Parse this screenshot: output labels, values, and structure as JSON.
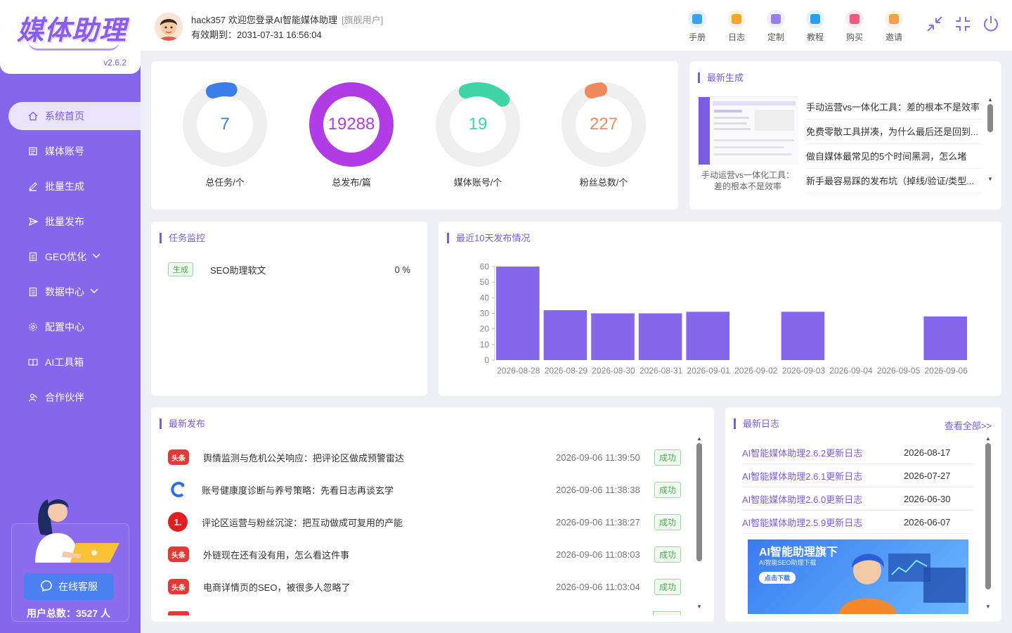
{
  "brand": {
    "logo": "媒体助理",
    "version": "v2.6.2",
    "accent": "#8666ea"
  },
  "sidebar": {
    "items": [
      {
        "label": "系统首页",
        "icon": "home-icon",
        "active": true
      },
      {
        "label": "媒体账号",
        "icon": "list-icon"
      },
      {
        "label": "批量生成",
        "icon": "edit-icon"
      },
      {
        "label": "批量发布",
        "icon": "send-icon"
      },
      {
        "label": "GEO优化",
        "icon": "doc-icon",
        "expandable": true
      },
      {
        "label": "数据中心",
        "icon": "doc-icon",
        "expandable": true
      },
      {
        "label": "配置中心",
        "icon": "gear-icon"
      },
      {
        "label": "AI工具箱",
        "icon": "book-icon"
      },
      {
        "label": "合作伙伴",
        "icon": "user-icon"
      }
    ],
    "support_label": "在线客服",
    "user_total": "用户总数：3527 人"
  },
  "header": {
    "welcome": "hack357 欢迎您登录AI智能媒体助理",
    "user_tag": "[旗舰用户]",
    "expiry": "有效期到：2031-07-31 16:56:04",
    "tools": [
      {
        "label": "手册",
        "color": "#3aa0f0"
      },
      {
        "label": "日志",
        "color": "#f5a623"
      },
      {
        "label": "定制",
        "color": "#9b7ee8"
      },
      {
        "label": "教程",
        "color": "#2a9df4"
      },
      {
        "label": "购买",
        "color": "#f05a7e"
      },
      {
        "label": "邀请",
        "color": "#f5a047"
      }
    ]
  },
  "stats": [
    {
      "value": "7",
      "label": "总任务/个",
      "color": "#3b7ee8",
      "fill": 0.08
    },
    {
      "value": "19288",
      "label": "总发布/篇",
      "color": "#b13ce6",
      "fill": 1.0
    },
    {
      "value": "19",
      "label": "媒体账号/个",
      "color": "#3ed6a6",
      "fill": 0.18
    },
    {
      "value": "227",
      "label": "粉丝总数/个",
      "color": "#f08a5e",
      "fill": 0.04
    }
  ],
  "latest_gen": {
    "title": "最新生成",
    "caption": "手动运营vs一体化工具：差的根本不是效率",
    "items": [
      "手动运营vs一体化工具：差的根本不是效率",
      "免费零散工具拼凑，为什么最后还是回到...",
      "做自媒体最常见的5个时间黑洞，怎么堵",
      "新手最容易踩的发布坑（掉线/验证/类型..."
    ]
  },
  "task_monitor": {
    "title": "任务监控",
    "tasks": [
      {
        "badge": "生成",
        "name": "SEO助理软文",
        "progress": "0 %"
      }
    ]
  },
  "chart_data": {
    "type": "bar",
    "title": "最近10天发布情况",
    "categories": [
      "2026-08-28",
      "2026-08-29",
      "2026-08-30",
      "2026-08-31",
      "2026-09-01",
      "2026-09-02",
      "2026-09-03",
      "2026-09-04",
      "2026-09-05",
      "2026-09-06"
    ],
    "values": [
      60,
      32,
      30,
      30,
      31,
      0,
      31,
      0,
      0,
      28
    ],
    "yticks": [
      "0",
      "10",
      "20",
      "30",
      "40",
      "50",
      "60"
    ],
    "ylim": [
      0,
      60
    ],
    "color": "#8666ea"
  },
  "latest_pub": {
    "title": "最新发布",
    "rows": [
      {
        "platform": "toutiao",
        "title": "舆情监测与危机公关响应：把评论区做成预警雷达",
        "time": "2026-09-06 11:39:50",
        "status": "成功"
      },
      {
        "platform": "cblue",
        "title": "账号健康度诊断与养号策略：先看日志再谈玄学",
        "time": "2026-09-06 11:38:38",
        "status": "成功"
      },
      {
        "platform": "yidian",
        "title": "评论区运营与粉丝沉淀：把互动做成可复用的产能",
        "time": "2026-09-06 11:38:27",
        "status": "成功"
      },
      {
        "platform": "toutiao",
        "title": "外链现在还有没有用，怎么看这件事",
        "time": "2026-09-06 11:08:03",
        "status": "成功"
      },
      {
        "platform": "toutiao",
        "title": "电商详情页的SEO，被很多人忽略了",
        "time": "2026-09-06 11:03:04",
        "status": "成功"
      }
    ]
  },
  "latest_log": {
    "title": "最新日志",
    "view_all": "查看全部>>",
    "rows": [
      {
        "title": "AI智能媒体助理2.6.2更新日志",
        "date": "2026-08-17"
      },
      {
        "title": "AI智能媒体助理2.6.1更新日志",
        "date": "2026-07-27"
      },
      {
        "title": "AI智能媒体助理2.6.0更新日志",
        "date": "2026-06-30"
      },
      {
        "title": "AI智能媒体助理2.5.9更新日志",
        "date": "2026-06-07"
      }
    ],
    "banner_title": "AI智能助理旗下",
    "banner_sub": "AI智能SEO助理下载",
    "banner_btn": "点击下载"
  },
  "platform_icons": {
    "toutiao": "头条",
    "yidian": "1."
  }
}
